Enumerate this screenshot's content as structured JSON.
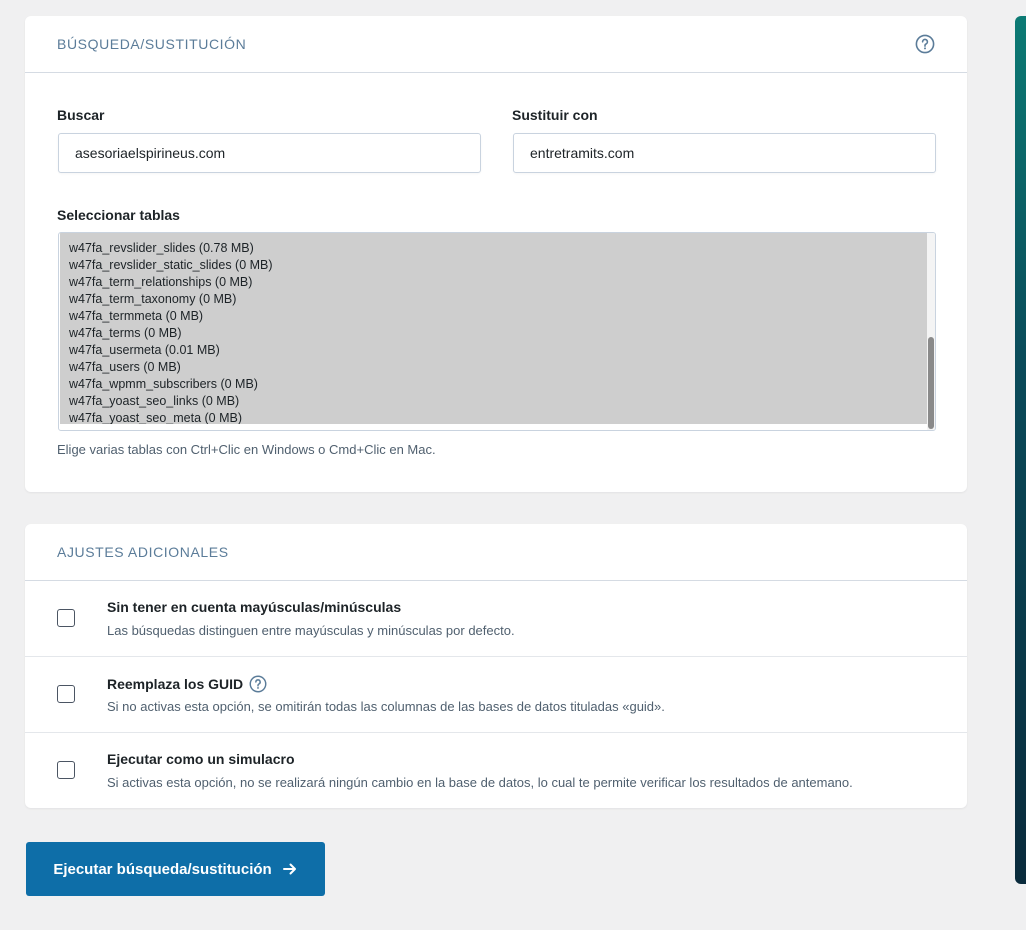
{
  "search_card": {
    "title": "BÚSQUEDA/SUSTITUCIÓN",
    "help_icon": "question-circle-icon",
    "search_label": "Buscar",
    "search_value": "asesoriaelspirineus.com",
    "replace_label": "Sustituir con",
    "replace_value": "entretramits.com",
    "tables_label": "Seleccionar tablas",
    "tables": [
      "w47fa_revslider_slides (0.78 MB)",
      "w47fa_revslider_static_slides (0 MB)",
      "w47fa_term_relationships (0 MB)",
      "w47fa_term_taxonomy (0 MB)",
      "w47fa_termmeta (0 MB)",
      "w47fa_terms (0 MB)",
      "w47fa_usermeta (0.01 MB)",
      "w47fa_users (0 MB)",
      "w47fa_wpmm_subscribers (0 MB)",
      "w47fa_yoast_seo_links (0 MB)",
      "w47fa_yoast_seo_meta (0 MB)"
    ],
    "tables_hint": "Elige varias tablas con Ctrl+Clic en Windows o Cmd+Clic en Mac."
  },
  "settings_card": {
    "title": "AJUSTES ADICIONALES",
    "options": [
      {
        "title": "Sin tener en cuenta mayúsculas/minúsculas",
        "description": "Las búsquedas distinguen entre mayúsculas y minúsculas por defecto.",
        "checked": false
      },
      {
        "title": "Reemplaza los GUID",
        "description": "Si no activas esta opción, se omitirán todas las columnas de las bases de datos tituladas «guid».",
        "checked": false,
        "has_help": true
      },
      {
        "title": "Ejecutar como un simulacro",
        "description": "Si activas esta opción, no se realizará ningún cambio en la base de datos, lo cual te permite verificar los resultados de antemano.",
        "checked": false
      }
    ]
  },
  "run_button": {
    "label": "Ejecutar búsqueda/sustitución",
    "icon": "arrow-right-icon"
  },
  "colors": {
    "accent": "#0e6ea8",
    "page_bg": "#f0f0f1",
    "card_bg": "#ffffff",
    "heading": "#5b7c99",
    "selected_bg": "#cecece"
  }
}
